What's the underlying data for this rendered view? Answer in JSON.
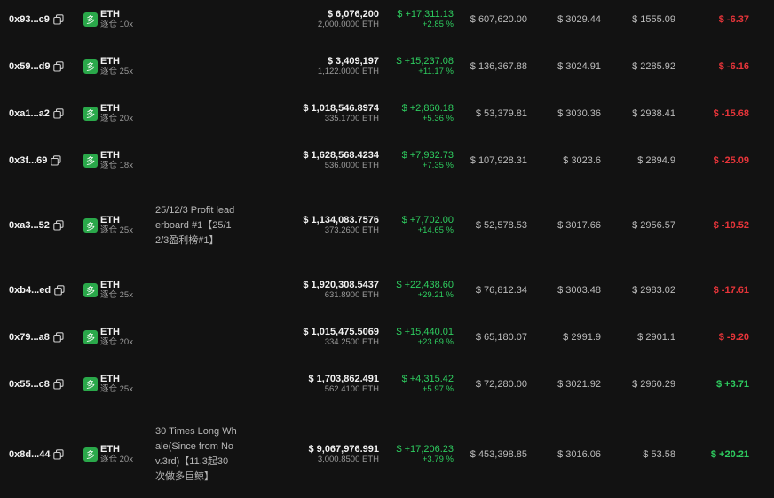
{
  "colors": {
    "background": "#121212",
    "positive": "#2ecc5f",
    "negative": "#e8353a",
    "long_badge": "#2aa84a"
  },
  "icons": {
    "copy": "copy-icon",
    "side": "long-badge"
  },
  "rows": [
    {
      "address": "0x93...c9",
      "side": "多",
      "coin": "ETH",
      "leverage": "逐仓 10x",
      "note": "",
      "value": "$ 6,076,200",
      "size": "2,000.0000 ETH",
      "pnl": "$ +17,311.13",
      "pnl_pct": "+2.85 %",
      "margin": "$ 607,620.00",
      "entry": "$ 3029.44",
      "liq": "$ 1555.09",
      "funding": "$ -6.37",
      "funding_sign": "neg"
    },
    {
      "address": "0x59...d9",
      "side": "多",
      "coin": "ETH",
      "leverage": "逐仓 25x",
      "note": "",
      "value": "$ 3,409,197",
      "size": "1,122.0000 ETH",
      "pnl": "$ +15,237.08",
      "pnl_pct": "+11.17 %",
      "margin": "$ 136,367.88",
      "entry": "$ 3024.91",
      "liq": "$ 2285.92",
      "funding": "$ -6.16",
      "funding_sign": "neg"
    },
    {
      "address": "0xa1...a2",
      "side": "多",
      "coin": "ETH",
      "leverage": "逐仓 20x",
      "note": "",
      "value": "$ 1,018,546.8974",
      "size": "335.1700 ETH",
      "pnl": "$ +2,860.18",
      "pnl_pct": "+5.36 %",
      "margin": "$ 53,379.81",
      "entry": "$ 3030.36",
      "liq": "$ 2938.41",
      "funding": "$ -15.68",
      "funding_sign": "neg"
    },
    {
      "address": "0x3f...69",
      "side": "多",
      "coin": "ETH",
      "leverage": "逐仓 18x",
      "note": "",
      "value": "$ 1,628,568.4234",
      "size": "536.0000 ETH",
      "pnl": "$ +7,932.73",
      "pnl_pct": "+7.35 %",
      "margin": "$ 107,928.31",
      "entry": "$ 3023.6",
      "liq": "$ 2894.9",
      "funding": "$ -25.09",
      "funding_sign": "neg"
    },
    {
      "address": "0xa3...52",
      "side": "多",
      "coin": "ETH",
      "leverage": "逐仓 25x",
      "note": "25/12/3 Profit leaderboard #1【25/12/3盈利榜#1】",
      "value": "$ 1,134,083.7576",
      "size": "373.2600 ETH",
      "pnl": "$ +7,702.00",
      "pnl_pct": "+14.65 %",
      "margin": "$ 52,578.53",
      "entry": "$ 3017.66",
      "liq": "$ 2956.57",
      "funding": "$ -10.52",
      "funding_sign": "neg"
    },
    {
      "address": "0xb4...ed",
      "side": "多",
      "coin": "ETH",
      "leverage": "逐仓 25x",
      "note": "",
      "value": "$ 1,920,308.5437",
      "size": "631.8900 ETH",
      "pnl": "$ +22,438.60",
      "pnl_pct": "+29.21 %",
      "margin": "$ 76,812.34",
      "entry": "$ 3003.48",
      "liq": "$ 2983.02",
      "funding": "$ -17.61",
      "funding_sign": "neg"
    },
    {
      "address": "0x79...a8",
      "side": "多",
      "coin": "ETH",
      "leverage": "逐仓 20x",
      "note": "",
      "value": "$ 1,015,475.5069",
      "size": "334.2500 ETH",
      "pnl": "$ +15,440.01",
      "pnl_pct": "+23.69 %",
      "margin": "$ 65,180.07",
      "entry": "$ 2991.9",
      "liq": "$ 2901.1",
      "funding": "$ -9.20",
      "funding_sign": "neg"
    },
    {
      "address": "0x55...c8",
      "side": "多",
      "coin": "ETH",
      "leverage": "逐仓 25x",
      "note": "",
      "value": "$ 1,703,862.491",
      "size": "562.4100 ETH",
      "pnl": "$ +4,315.42",
      "pnl_pct": "+5.97 %",
      "margin": "$ 72,280.00",
      "entry": "$ 3021.92",
      "liq": "$ 2960.29",
      "funding": "$ +3.71",
      "funding_sign": "pos"
    },
    {
      "address": "0x8d...44",
      "side": "多",
      "coin": "ETH",
      "leverage": "逐仓 20x",
      "note": "30 Times Long Whale(Since from Nov.3rd)【11.3起30次做多巨鲸】",
      "value": "$ 9,067,976.991",
      "size": "3,000.8500 ETH",
      "pnl": "$ +17,206.23",
      "pnl_pct": "+3.79 %",
      "margin": "$ 453,398.85",
      "entry": "$ 3016.06",
      "liq": "$ 53.58",
      "funding": "$ +20.21",
      "funding_sign": "pos"
    }
  ]
}
